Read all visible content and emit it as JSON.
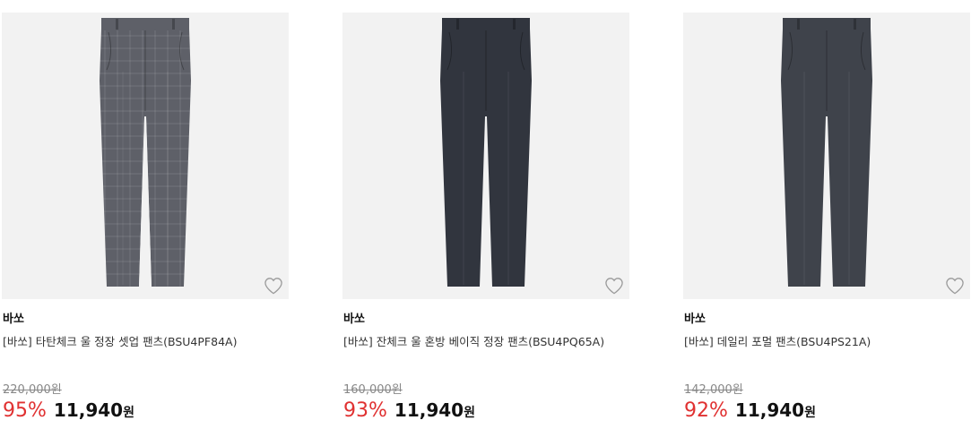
{
  "products": [
    {
      "brand": "바쏘",
      "title": "[바쏘] 타탄체크 울 정장 셋업 팬츠(BSU4PF84A)",
      "original_price": "220,000원",
      "discount": "95%",
      "sale_price": "11,940",
      "currency": "원",
      "pants_color": "#5e6068",
      "pattern": "check"
    },
    {
      "brand": "바쏘",
      "title": "[바쏘] 잔체크 울 혼방 베이직 정장 팬츠(BSU4PQ65A)",
      "original_price": "160,000원",
      "discount": "93%",
      "sale_price": "11,940",
      "currency": "원",
      "pants_color": "#31353e",
      "pattern": "plain"
    },
    {
      "brand": "바쏘",
      "title": "[바쏘] 데일리 포멀 팬츠(BSU4PS21A)",
      "original_price": "142,000원",
      "discount": "92%",
      "sale_price": "11,940",
      "currency": "원",
      "pants_color": "#3f434b",
      "pattern": "plain"
    }
  ],
  "colors": {
    "discount": "#e03131",
    "image_background": "#f2f2f2",
    "heart_outline": "#9a9a9a"
  }
}
